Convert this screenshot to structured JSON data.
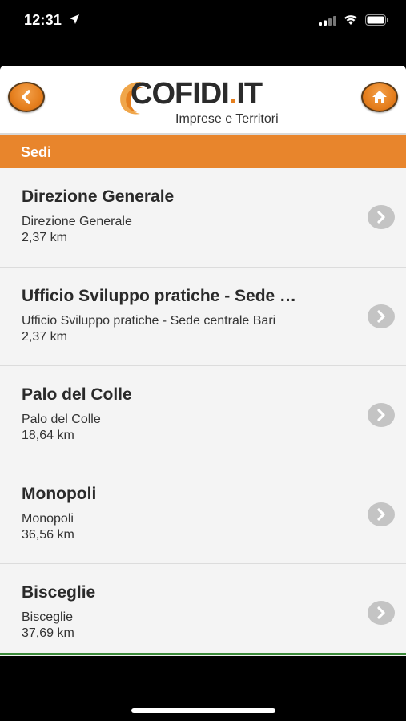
{
  "status_bar": {
    "time": "12:31"
  },
  "header": {
    "back_icon": "chevron-left-icon",
    "home_icon": "home-icon",
    "logo": {
      "name_main": "COFIDI",
      "name_dot": ".",
      "name_tld": "IT",
      "tagline": "Imprese e Territori"
    }
  },
  "section": {
    "title": "Sedi"
  },
  "list": {
    "items": [
      {
        "title": "Direzione Generale",
        "subtitle": "Direzione Generale",
        "distance": "2,37 km"
      },
      {
        "title": "Ufficio Sviluppo pratiche - Sede …",
        "subtitle": "Ufficio Sviluppo pratiche - Sede centrale Bari",
        "distance": "2,37 km"
      },
      {
        "title": "Palo del Colle",
        "subtitle": "Palo del Colle",
        "distance": "18,64 km"
      },
      {
        "title": "Monopoli",
        "subtitle": "Monopoli",
        "distance": "36,56 km"
      },
      {
        "title": "Bisceglie",
        "subtitle": "Bisceglie",
        "distance": "37,69 km"
      }
    ]
  },
  "colors": {
    "accent": "#e8852c",
    "header_bg": "#ffffff",
    "list_bg": "#f4f4f4",
    "chevron_bg": "#c4c4c4"
  }
}
